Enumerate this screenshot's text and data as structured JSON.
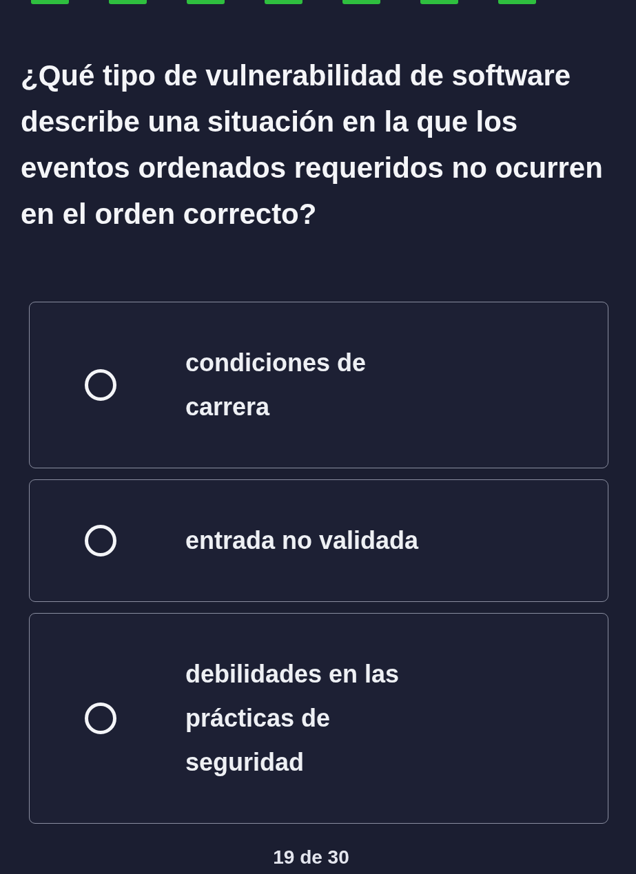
{
  "progress_segments": [
    {
      "filled": true
    },
    {
      "filled": true
    },
    {
      "filled": true
    },
    {
      "filled": true
    },
    {
      "filled": true
    },
    {
      "filled": true
    },
    {
      "filled": true
    }
  ],
  "question": "¿Qué tipo de vulnerabilidad de software describe una situación en la que los eventos ordenados requeridos no ocurren en el orden correcto?",
  "options": [
    {
      "label": "condiciones de carrera",
      "selected": false
    },
    {
      "label": "entrada no validada",
      "selected": false
    },
    {
      "label": "debilidades en las prácticas de seguridad",
      "selected": false
    }
  ],
  "counter": "19 de 30"
}
